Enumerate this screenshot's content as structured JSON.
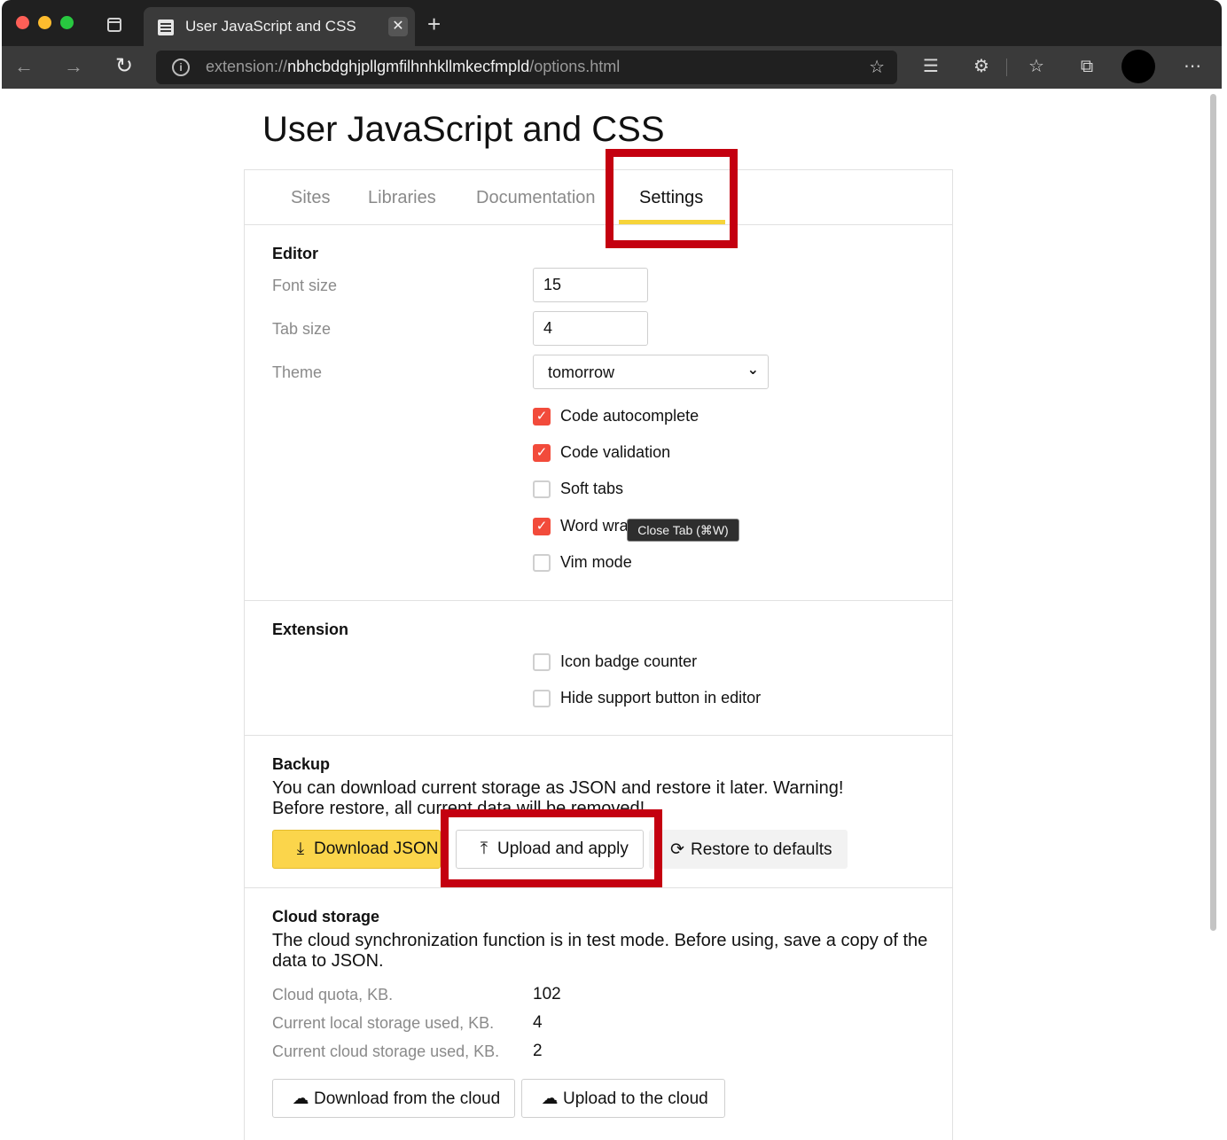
{
  "browser": {
    "tab_title": "User JavaScript and CSS",
    "tab_close_glyph": "✕",
    "new_tab_glyph": "+",
    "url_scheme": "extension://",
    "url_host": "nbhcbdghjpllgmfilhnhkllmkecfmpld",
    "url_path": "/options.html",
    "icons": [
      "back-icon",
      "forward-icon",
      "reload-icon",
      "info-icon",
      "favorite-add-icon",
      "reader-icon",
      "extensions-icon",
      "favorites-icon",
      "collections-icon",
      "profile-avatar",
      "more-icon"
    ]
  },
  "page": {
    "title": "User JavaScript and CSS",
    "tabs": [
      {
        "label": "Sites"
      },
      {
        "label": "Libraries"
      },
      {
        "label": "Documentation"
      },
      {
        "label": "Settings",
        "active": true
      }
    ],
    "accent_color": "#f6d43a",
    "check_color": "#f24b3b"
  },
  "editor": {
    "heading": "Editor",
    "font_size_label": "Font size",
    "font_size_value": "15",
    "tab_size_label": "Tab size",
    "tab_size_value": "4",
    "theme_label": "Theme",
    "theme_value": "tomorrow",
    "options": [
      {
        "label": "Code autocomplete",
        "checked": true
      },
      {
        "label": "Code validation",
        "checked": true
      },
      {
        "label": "Soft tabs",
        "checked": false
      },
      {
        "label": "Word wra",
        "checked": true
      },
      {
        "label": "Vim mode",
        "checked": false
      }
    ]
  },
  "extension": {
    "heading": "Extension",
    "options": [
      {
        "label": "Icon badge counter",
        "checked": false
      },
      {
        "label": "Hide support button in editor",
        "checked": false
      }
    ]
  },
  "backup": {
    "heading": "Backup",
    "description_line1": "You can download current storage as JSON and restore it later. Warning!",
    "description_line2": "Before restore, all current data will be removed!",
    "download_label": "Download JSON",
    "upload_label": "Upload and apply",
    "restore_label": "Restore to defaults"
  },
  "cloud": {
    "heading": "Cloud storage",
    "description": "The cloud synchronization function is in test mode. Before using, save a copy of the data to JSON.",
    "quota_label": "Cloud quota, KB.",
    "quota_value": "102",
    "local_used_label": "Current local storage used, KB.",
    "local_used_value": "4",
    "cloud_used_label": "Current cloud storage used, KB.",
    "cloud_used_value": "2",
    "download_label": "Download from the cloud",
    "upload_label": "Upload to the cloud"
  },
  "tooltip": {
    "text": "Close Tab (⌘W)"
  },
  "highlight_color": "#c40010"
}
